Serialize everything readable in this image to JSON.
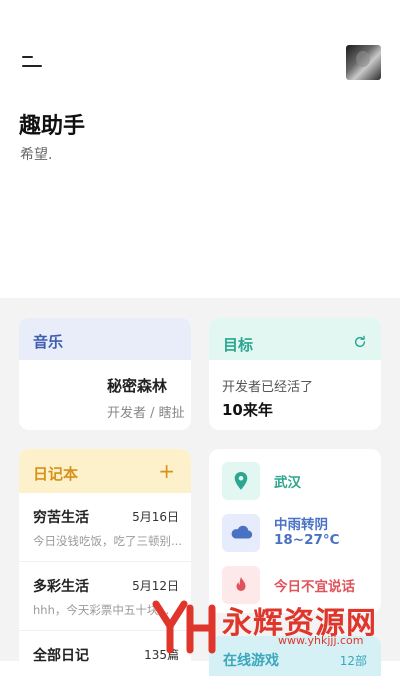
{
  "header": {
    "app_title": "趣助手",
    "subtitle": "希望."
  },
  "music": {
    "label": "音乐",
    "song": "秘密森林",
    "artist": "开发者 / 瞎扯"
  },
  "goal": {
    "label": "目标",
    "text": "开发者已经活了",
    "value": "10来年"
  },
  "diary": {
    "label": "日记本",
    "items": [
      {
        "title": "穷苦生活",
        "date": "5月16日",
        "preview": "今日没钱吃饭，吃了三顿别..."
      },
      {
        "title": "多彩生活",
        "date": "5月12日",
        "preview": "hhh，今天彩票中五十块..."
      },
      {
        "title": "全部日记",
        "date": "135篇",
        "preview": ""
      }
    ]
  },
  "info": {
    "location": "武汉",
    "weather_line1": "中雨转阴",
    "weather_line2": "18~27°C",
    "warning": "今日不宜说话"
  },
  "games": {
    "label": "在线游戏",
    "count": "12部"
  },
  "watermark": {
    "text": "永辉资源网",
    "url": "www.yhkjjj.com"
  },
  "colors": {
    "music": "#3f5db0",
    "goal": "#2ba68f",
    "diary": "#d6921a",
    "weather": "#4a72c4",
    "warning": "#e0535b",
    "games": "#3aa7bd"
  }
}
